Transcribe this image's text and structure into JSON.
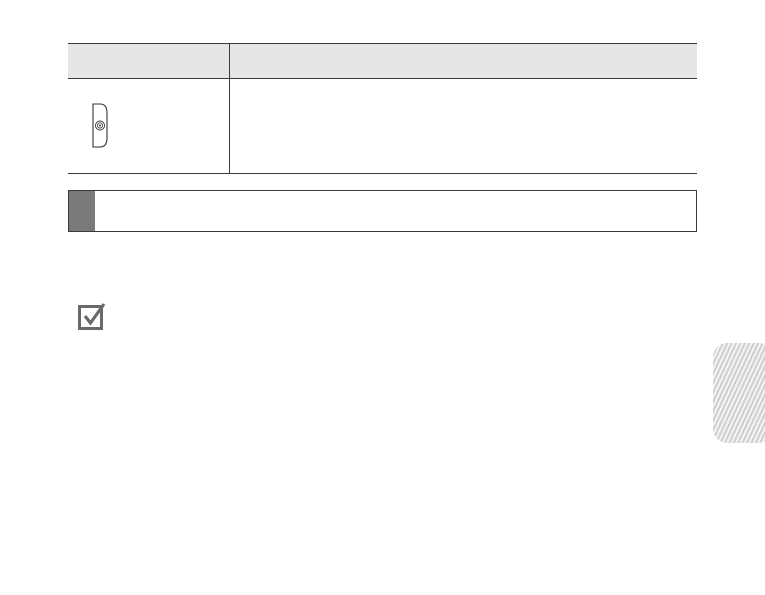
{
  "table": {
    "header_left": "",
    "header_right": "",
    "row1_description": "",
    "key_icon": "side-key-icon"
  },
  "notice": {
    "text": "",
    "marker_color": "#7a7a7a"
  },
  "note": {
    "icon": "checkbox-check-icon",
    "text": ""
  },
  "side_tab": {
    "label": "",
    "colors": [
      "#cfcfcf",
      "#f4f4f4"
    ]
  }
}
